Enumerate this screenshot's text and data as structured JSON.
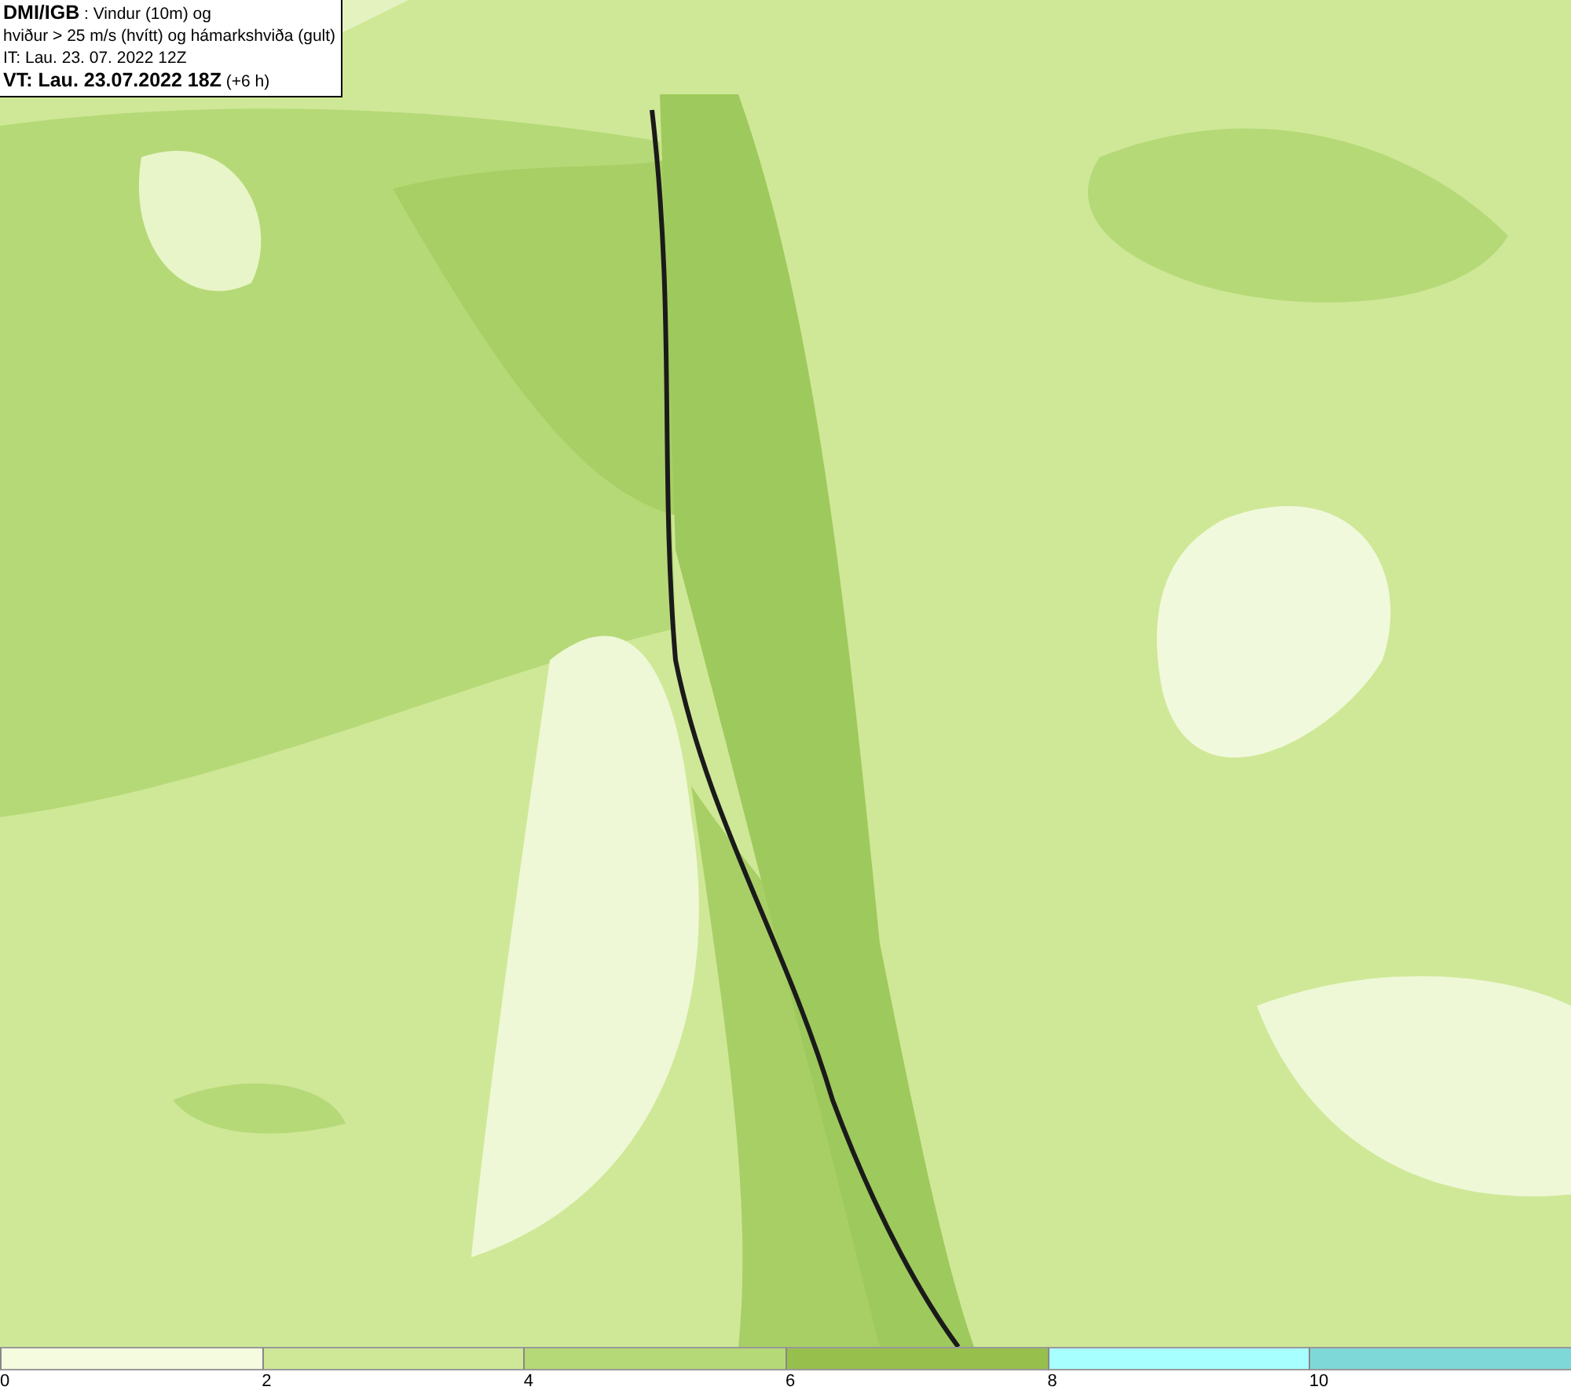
{
  "header": {
    "lines": [
      "**DMI/IGB** : Vindur (10m) og",
      "hviður > 25 m/s (hvítt) og hámarkshviða (gult)",
      "IT: Lau. 23. 07. 2022 12Z",
      "**VT: Lau. 23.07.2022 18Z** (+6 h)"
    ]
  },
  "legend": {
    "bins": [
      {
        "label": "0",
        "color": "#f4fbdf"
      },
      {
        "label": "2",
        "color": "#cfe897"
      },
      {
        "label": "4",
        "color": "#b5d977"
      },
      {
        "label": "6",
        "color": "#97bf4c"
      },
      {
        "label": "8",
        "color": "#a8ffff"
      },
      {
        "label": "10",
        "color": "#7fd8d8"
      }
    ]
  }
}
